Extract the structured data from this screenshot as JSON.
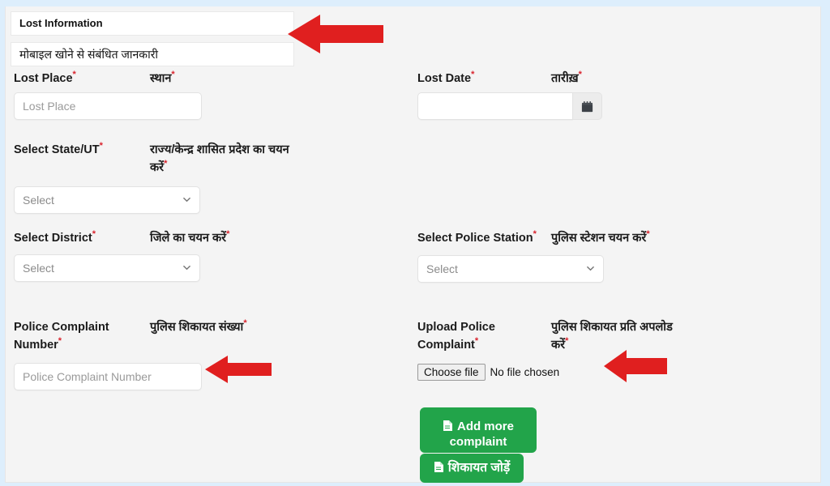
{
  "page": {
    "background_color": "#ddeefc",
    "panel_color": "#f4f4f4",
    "accent_red": "#e01f1f",
    "accent_green": "#22a44a",
    "required_star": "*"
  },
  "header": {
    "tab_en": "Lost Information",
    "tab_hi": "मोबाइल खोने से संबंधित जानकारी"
  },
  "form": {
    "lost_place": {
      "label_en": "Lost Place",
      "label_hi": "स्थान",
      "placeholder": "Lost Place",
      "value": ""
    },
    "lost_date": {
      "label_en": "Lost Date",
      "label_hi": "तारीख़",
      "placeholder": "",
      "value": "",
      "button_icon": "calendar-icon"
    },
    "state_ut": {
      "label_en": "Select State/UT",
      "label_hi": "राज्य/केन्द्र शासित प्रदेश का चयन करें",
      "selected": "Select",
      "options": [
        "Select"
      ]
    },
    "district": {
      "label_en": "Select District",
      "label_hi": "जिले का चयन करें",
      "selected": "Select",
      "options": [
        "Select"
      ]
    },
    "police_station": {
      "label_en": "Select Police Station",
      "label_hi": "पुलिस स्टेशन चयन करें",
      "selected": "Select",
      "options": [
        "Select"
      ]
    },
    "complaint_number": {
      "label_en": "Police Complaint Number",
      "label_hi": "पुलिस शिकायत संख्या",
      "placeholder": "Police Complaint Number",
      "value": ""
    },
    "upload_complaint": {
      "label_en": "Upload Police Complaint",
      "label_hi": "पुलिस शिकायत प्रति अपलोड करें",
      "button_label": "Choose file",
      "status_text": "No file chosen"
    }
  },
  "actions": {
    "add_more_en": "Add more complaint",
    "add_more_hi": "शिकायत जोड़ें",
    "icon": "document-icon"
  },
  "annotations": {
    "arrow_color": "#e01f1f",
    "arrows": [
      {
        "name": "arrow-pointing-header",
        "target": "header-tabs"
      },
      {
        "name": "arrow-pointing-complaint-number",
        "target": "complaint-number-input"
      },
      {
        "name": "arrow-pointing-upload",
        "target": "upload-file-input"
      }
    ]
  }
}
